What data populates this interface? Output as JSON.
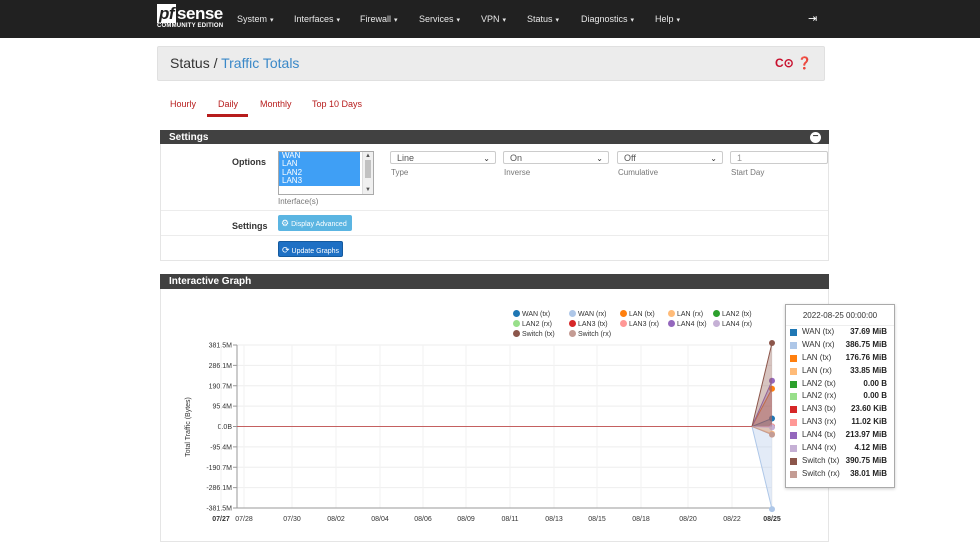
{
  "brand": {
    "logo_prefix": "pf",
    "logo_word": "sense",
    "edition": "COMMUNITY EDITION"
  },
  "nav": {
    "items": [
      {
        "label": "System",
        "x": 237
      },
      {
        "label": "Interfaces",
        "x": 294
      },
      {
        "label": "Firewall",
        "x": 360
      },
      {
        "label": "Services",
        "x": 419
      },
      {
        "label": "VPN",
        "x": 481
      },
      {
        "label": "Status",
        "x": 527
      },
      {
        "label": "Diagnostics",
        "x": 581
      },
      {
        "label": "Help",
        "x": 655
      }
    ],
    "caret": "▾",
    "logout_icon": "⇥"
  },
  "page": {
    "title_prefix": "Status /",
    "title_crumb": "Traffic Totals",
    "icons": "C⊙ ❓"
  },
  "tabs": [
    {
      "label": "Hourly"
    },
    {
      "label": "Daily",
      "active": true
    },
    {
      "label": "Monthly"
    },
    {
      "label": "Top 10 Days"
    }
  ],
  "settings": {
    "header": "Settings",
    "options_label": "Options",
    "interfaces": [
      "WAN",
      "LAN",
      "LAN2",
      "LAN3"
    ],
    "interfaces_help": "Interface(s)",
    "type": {
      "value": "Line",
      "help": "Type"
    },
    "inverse": {
      "value": "On",
      "help": "Inverse"
    },
    "cumulative": {
      "value": "Off",
      "help": "Cumulative"
    },
    "start_day": {
      "value": "1",
      "help": "Start Day"
    },
    "settings_label": "Settings",
    "display_advanced": "Display Advanced",
    "update_graphs": "Update Graphs"
  },
  "graph": {
    "header": "Interactive Graph"
  },
  "tooltip": {
    "title": "2022-08-25 00:00:00",
    "rows": [
      {
        "name": "WAN (tx)",
        "value": "37.69 MiB",
        "color": "#1f77b4"
      },
      {
        "name": "WAN (rx)",
        "value": "386.75 MiB",
        "color": "#aec7e8"
      },
      {
        "name": "LAN (tx)",
        "value": "176.76 MiB",
        "color": "#ff7f0e"
      },
      {
        "name": "LAN (rx)",
        "value": "33.85 MiB",
        "color": "#ffbb78"
      },
      {
        "name": "LAN2 (tx)",
        "value": "0.00 B",
        "color": "#2ca02c"
      },
      {
        "name": "LAN2 (rx)",
        "value": "0.00 B",
        "color": "#98df8a"
      },
      {
        "name": "LAN3 (tx)",
        "value": "23.60 KiB",
        "color": "#d62728"
      },
      {
        "name": "LAN3 (rx)",
        "value": "11.02 KiB",
        "color": "#ff9896"
      },
      {
        "name": "LAN4 (tx)",
        "value": "213.97 MiB",
        "color": "#9467bd"
      },
      {
        "name": "LAN4 (rx)",
        "value": "4.12 MiB",
        "color": "#c5b0d5"
      },
      {
        "name": "Switch (tx)",
        "value": "390.75 MiB",
        "color": "#8c564b"
      },
      {
        "name": "Switch (rx)",
        "value": "38.01 MiB",
        "color": "#c49c94"
      }
    ]
  },
  "chart_data": {
    "type": "line",
    "ylabel": "Total Traffic (Bytes)",
    "ylim": [
      -381.5,
      381.5
    ],
    "y_unit": "MiB",
    "y_ticks": [
      "381.5M",
      "286.1M",
      "190.7M",
      "95.4M",
      "0.0B",
      "-95.4M",
      "-190.7M",
      "-286.1M",
      "-381.5M"
    ],
    "x_ticks": [
      "07/27",
      "07/28",
      "07/30",
      "08/02",
      "08/04",
      "08/06",
      "08/09",
      "08/11",
      "08/13",
      "08/15",
      "08/18",
      "08/20",
      "08/22",
      "08/25"
    ],
    "x_tick_bold": [
      "07/27",
      "08/25"
    ],
    "x": [
      "08/24",
      "08/25"
    ],
    "series": [
      {
        "name": "WAN (tx)",
        "color": "#1f77b4",
        "values": [
          0,
          37.69
        ]
      },
      {
        "name": "WAN (rx)",
        "color": "#aec7e8",
        "values": [
          0,
          -386.75
        ]
      },
      {
        "name": "LAN (tx)",
        "color": "#ff7f0e",
        "values": [
          0,
          176.76
        ]
      },
      {
        "name": "LAN (rx)",
        "color": "#ffbb78",
        "values": [
          0,
          -33.85
        ]
      },
      {
        "name": "LAN2 (tx)",
        "color": "#2ca02c",
        "values": [
          0,
          0
        ]
      },
      {
        "name": "LAN2 (rx)",
        "color": "#98df8a",
        "values": [
          0,
          0
        ]
      },
      {
        "name": "LAN3 (tx)",
        "color": "#d62728",
        "values": [
          0,
          0.02
        ]
      },
      {
        "name": "LAN3 (rx)",
        "color": "#ff9896",
        "values": [
          0,
          -0.01
        ]
      },
      {
        "name": "LAN4 (tx)",
        "color": "#9467bd",
        "values": [
          0,
          213.97
        ]
      },
      {
        "name": "LAN4 (rx)",
        "color": "#c5b0d5",
        "values": [
          0,
          -4.12
        ]
      },
      {
        "name": "Switch (tx)",
        "color": "#8c564b",
        "values": [
          0,
          390.75
        ]
      },
      {
        "name": "Switch (rx)",
        "color": "#c49c94",
        "values": [
          0,
          -38.01
        ]
      }
    ],
    "legend": "top-right",
    "grid": true
  }
}
